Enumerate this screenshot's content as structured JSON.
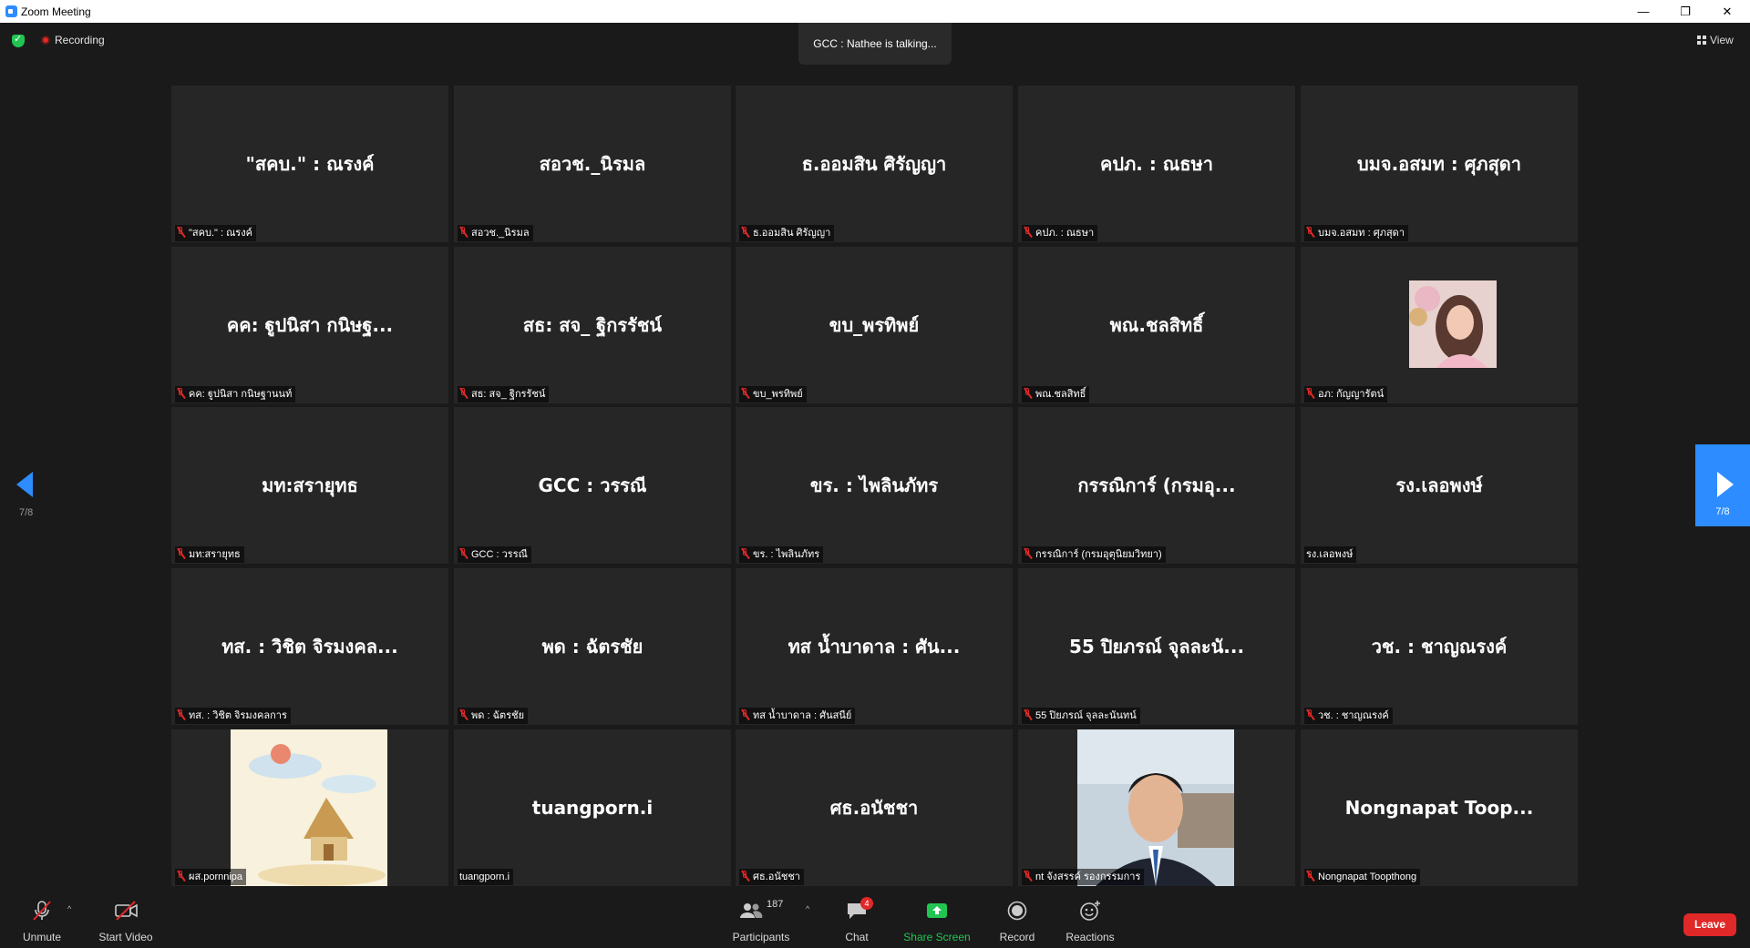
{
  "window": {
    "title": "Zoom Meeting"
  },
  "topbar": {
    "recording_label": "Recording",
    "talking_text": "GCC : Nathee is talking...",
    "view_label": "View"
  },
  "pager": {
    "left_page": "7/8",
    "right_page": "7/8"
  },
  "tiles": [
    {
      "big": "\"สคบ.\" : ณรงค์",
      "label": "\"สคบ.\" : ณรงค์"
    },
    {
      "big": "สอวช._นิรมล",
      "label": "สอวช._นิรมล"
    },
    {
      "big": "ธ.ออมสิน ศิรัญญา",
      "label": "ธ.ออมสิน ศิรัญญา"
    },
    {
      "big": "คปภ. : ณธษา",
      "label": "คปภ. : ณธษา"
    },
    {
      "big": "บมจ.อสมท : ศุภสุดา",
      "label": "บมจ.อสมท : ศุภสุดา"
    },
    {
      "big": "คค: ฐูปนิสา กนิษฐ...",
      "label": "คค: ฐูปนิสา กนิษฐานนท์"
    },
    {
      "big": "สธ: สจ_ ฐิกรรัชน์",
      "label": "สธ: สจ_ ฐิกรรัชน์"
    },
    {
      "big": "ขบ_พรทิพย์",
      "label": "ขบ_พรทิพย์"
    },
    {
      "big": "พณ.ชลสิทธิ์",
      "label": "พณ.ชลสิทธิ์"
    },
    {
      "big": "",
      "label": "อภ: กัญญารัตน์"
    },
    {
      "big": "มท:สรายุทธ",
      "label": "มท:สรายุทธ"
    },
    {
      "big": "GCC :  วรรณี",
      "label": "GCC :  วรรณี"
    },
    {
      "big": "ขร. : ไพลินภัทร",
      "label": "ขร. : ไพลินภัทร"
    },
    {
      "big": "กรรณิการ์ (กรมอุ...",
      "label": "กรรณิการ์ (กรมอุตุนิยมวิทยา)"
    },
    {
      "big": "รง.เลอพงษ์",
      "label": "รง.เลอพงษ์"
    },
    {
      "big": "ทส. : วิชิต จิรมงคล...",
      "label": "ทส. : วิชิต จิรมงคลการ"
    },
    {
      "big": "พด : ฉัตรชัย",
      "label": "พด : ฉัตรชัย"
    },
    {
      "big": "ทส น้ำบาดาล : ศัน...",
      "label": "ทส น้ำบาดาล : ศันสนีย์"
    },
    {
      "big": "55 ปิยภรณ์ จุลละนั...",
      "label": "55 ปิยภรณ์ จุลละนันทน์"
    },
    {
      "big": "วช. : ชาญณรงค์",
      "label": "วช. : ชาญณรงค์"
    },
    {
      "big": "",
      "label": "ผส.pornnipa"
    },
    {
      "big": "tuangporn.i",
      "label": "tuangporn.i"
    },
    {
      "big": "ศธ.อนัชชา",
      "label": "ศธ.อนัชชา"
    },
    {
      "big": "",
      "label": "nt จังสรรค์ รองกรรมการ"
    },
    {
      "big": "Nongnapat  Toop...",
      "label": "Nongnapat Toopthong"
    }
  ],
  "toolbar": {
    "unmute": "Unmute",
    "start_video": "Start Video",
    "participants": "Participants",
    "participants_count": "187",
    "chat": "Chat",
    "chat_badge": "4",
    "share_screen": "Share Screen",
    "record": "Record",
    "reactions": "Reactions",
    "leave": "Leave"
  },
  "colors": {
    "accent": "#2d8cff",
    "danger": "#e02828",
    "share_green": "#23c552"
  }
}
